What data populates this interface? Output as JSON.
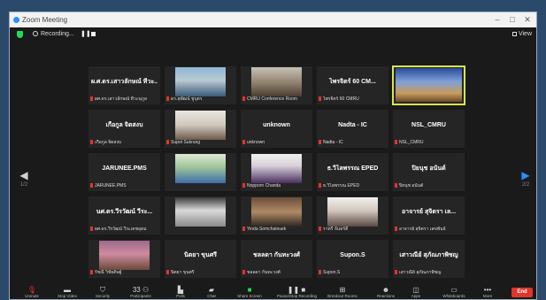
{
  "window": {
    "title": "Zoom Meeting",
    "controls": {
      "minimize": "–",
      "maximize": "□",
      "close": "✕"
    }
  },
  "topbar": {
    "recording_label": "Recording...",
    "pause": "❚❚",
    "view_label": "View"
  },
  "gallery": {
    "page_left": "1/2",
    "page_right": "2/2",
    "tiles": [
      {
        "name": "ผ.ศ.ดร.เสาวลักษณ์ ทีวะ...",
        "caption": "ผศ.ดร.เสาวลักษณ์ ทีวะนุกูล",
        "video": false,
        "speaking": false
      },
      {
        "name": "",
        "caption": "ดร.สุพัฒน์ ชูบุตร",
        "video": true,
        "speaking": false,
        "scene": "office"
      },
      {
        "name": "",
        "caption": "CMRU Conference Room",
        "video": true,
        "speaking": false,
        "scene": "room"
      },
      {
        "name": "ไพรจิตร์ 60 CM...",
        "caption": "ไพรจิตร์ 60 CMRU",
        "video": false,
        "speaking": false
      },
      {
        "name": "",
        "caption": "",
        "video": true,
        "speaking": true,
        "scene": "stage"
      },
      {
        "name": "เกื้อกูล จิตสงบ",
        "caption": "เกื้อกูล จิตสงบ",
        "video": false,
        "speaking": false
      },
      {
        "name": "",
        "caption": "Supot Sukrung",
        "video": true,
        "speaking": false,
        "scene": "person"
      },
      {
        "name": "unknown",
        "caption": "unknown",
        "video": false,
        "speaking": false
      },
      {
        "name": "Nadta - IC",
        "caption": "Nadta - IC",
        "video": false,
        "speaking": false
      },
      {
        "name": "NSL_CMRU",
        "caption": "NSL_CMRU",
        "video": false,
        "speaking": false
      },
      {
        "name": "JARUNEE.PMS",
        "caption": "JARUNEE.PMS",
        "video": false,
        "speaking": false
      },
      {
        "name": "",
        "caption": "",
        "video": true,
        "speaking": false,
        "scene": "person-green"
      },
      {
        "name": "",
        "caption": "Nopporn Chanda",
        "video": true,
        "speaking": false,
        "scene": "portrait"
      },
      {
        "name": "ธ.วิไลพรรณ EPED",
        "caption": "ธ.วิไลพรรณ EPED",
        "video": false,
        "speaking": false
      },
      {
        "name": "ปิยนุช อนันต์",
        "caption": "ปิยนุช อนันต์",
        "video": false,
        "speaking": false
      },
      {
        "name": "นศ.ดร.วีรวัฒน์ วีระ...",
        "caption": "ผศ.ดร.วีรวัฒน์ วีระเดชอุดม",
        "video": false,
        "speaking": false
      },
      {
        "name": "",
        "caption": "",
        "video": true,
        "speaking": false,
        "scene": "ceiling"
      },
      {
        "name": "",
        "caption": "Yinda Somchainuek",
        "video": true,
        "speaking": false,
        "scene": "person-dark"
      },
      {
        "name": "",
        "caption": "ราตรี จันทร์ดี",
        "video": true,
        "speaking": false,
        "scene": "portrait-f"
      },
      {
        "name": "อาจารย์ สุจิตรา เล...",
        "caption": "อาจารย์ สุจิตรา เลขพันธ์",
        "video": false,
        "speaking": false
      },
      {
        "name": "",
        "caption": "รัชณี วิชัยดิษฐ์",
        "video": true,
        "speaking": false,
        "scene": "group"
      },
      {
        "name": "นิตยา ขุนศรี",
        "caption": "นิตยา ขุนศรี",
        "video": false,
        "speaking": false
      },
      {
        "name": "ชลลดา กันทะวงศ์",
        "caption": "ชลลดา กันทะวงศ์",
        "video": false,
        "speaking": false
      },
      {
        "name": "Supon.S",
        "caption": "Supon.S",
        "video": false,
        "speaking": false
      },
      {
        "name": "เสาวณีย์ สุภัณภาพิชญ",
        "caption": "เสาวณีย์ สุภัณภาพิชญ",
        "video": false,
        "speaking": false
      }
    ]
  },
  "toolbar": {
    "unmute": "Unmute",
    "stop_video": "Stop Video",
    "security": "Security",
    "participants": "Participants",
    "participants_count": "33",
    "polls": "Polls",
    "chat": "Chat",
    "share_screen": "Share Screen",
    "pause_recording": "Pause/Stop Recording",
    "breakout": "Breakout Rooms",
    "reactions": "Reactions",
    "apps": "Apps",
    "whiteboards": "Whiteboards",
    "more": "More",
    "end": "End"
  },
  "colors": {
    "accent_green": "#23d959",
    "end_red": "#e0352b",
    "speaker_border": "#d6e84d",
    "desktop": "#2b4a6b"
  }
}
